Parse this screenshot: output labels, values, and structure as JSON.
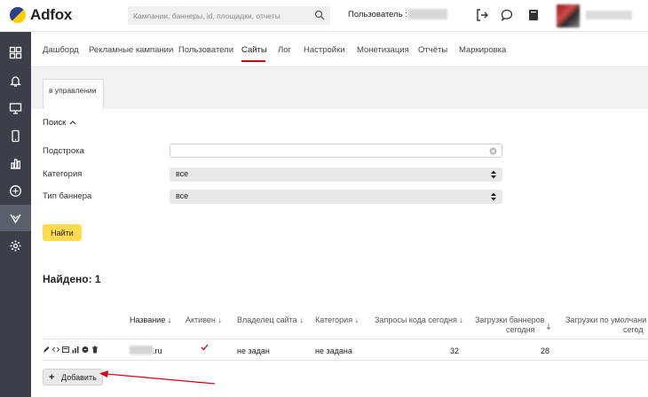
{
  "header": {
    "logo_text": "Adfox",
    "search_placeholder": "Кампании, баннеры, id, площадки, отчеты",
    "user_label": "Пользователь :"
  },
  "tabs": [
    {
      "label": "Дашборд"
    },
    {
      "label": "Рекламные кампании"
    },
    {
      "label": "Пользователи"
    },
    {
      "label": "Сайты"
    },
    {
      "label": "Лог"
    },
    {
      "label": "Настройки"
    },
    {
      "label": "Монетизация"
    },
    {
      "label": "Отчёты"
    },
    {
      "label": "Маркировка"
    }
  ],
  "subtab": {
    "label": "в управлении"
  },
  "search_form": {
    "title": "Поиск",
    "fields": [
      {
        "label": "Подстрока",
        "value": ""
      },
      {
        "label": "Категория",
        "value": "все"
      },
      {
        "label": "Тип баннера",
        "value": "все"
      }
    ],
    "submit_label": "Найти"
  },
  "results": {
    "found_label": "Найдено: 1",
    "columns": [
      {
        "label": "Название ↓"
      },
      {
        "label": "Активен ↓"
      },
      {
        "label": "Владелец сайта ↓"
      },
      {
        "label": "Категория ↓"
      },
      {
        "label": "Запросы кода сегодня ↓"
      },
      {
        "label": "Загрузки баннеров"
      },
      {
        "label": "сегодня"
      },
      {
        "label": "Загрузки по умолчани"
      },
      {
        "label": "сегод"
      }
    ],
    "rows": [
      {
        "site": ".ru",
        "owner": "не задан",
        "category": "не задана",
        "code_requests": "32",
        "banner_loads": "28"
      }
    ],
    "add_label": "Добавить"
  },
  "colors": {
    "accent": "#d0021b",
    "button_yellow": "#ffdb4d",
    "sidebar": "#3a3f48"
  }
}
